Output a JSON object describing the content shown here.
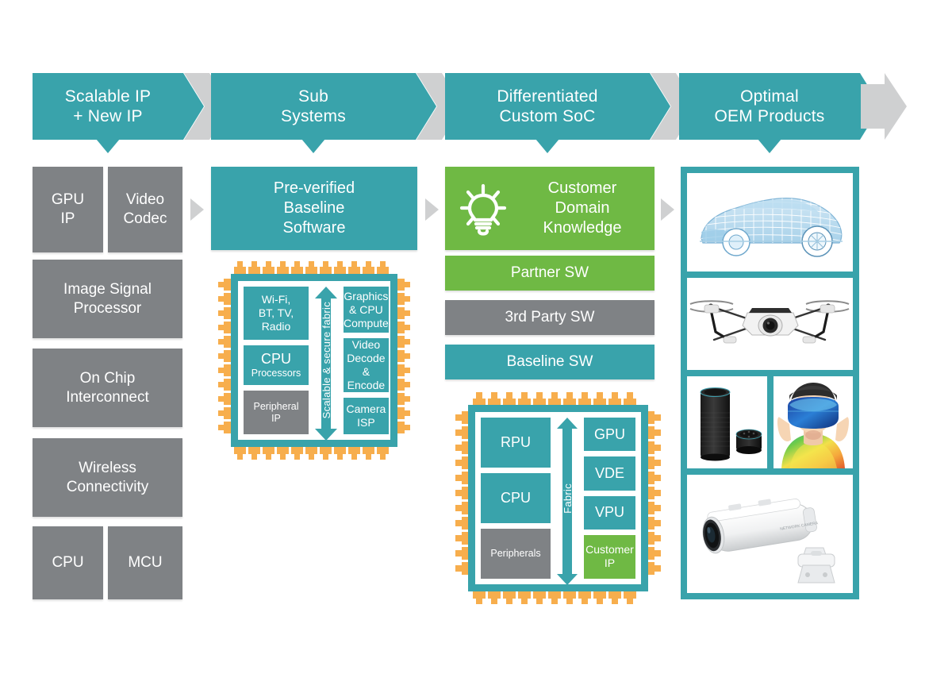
{
  "theme": {
    "teal": "#39A3AB",
    "green": "#6FB944",
    "gray": "#7F8285",
    "orange": "#F7AE4D",
    "arrow_gray": "#CFD0D1",
    "white": "#FFFFFF"
  },
  "headers": [
    {
      "label": "Scalable IP\n+ New IP",
      "name": "header-scalable-ip"
    },
    {
      "label": "Sub\nSystems",
      "name": "header-sub-systems"
    },
    {
      "label": "Differentiated\nCustom SoC",
      "name": "header-differentiated-custom-soc"
    },
    {
      "label": "Optimal\nOEM Products",
      "name": "header-optimal-oem-products"
    }
  ],
  "column1": {
    "blocks": [
      {
        "label": "GPU\nIP",
        "color": "gray"
      },
      {
        "label": "Video\nCodec",
        "color": "gray"
      },
      {
        "label": "Image Signal\nProcessor",
        "color": "gray"
      },
      {
        "label": "On Chip\nInterconnect",
        "color": "gray"
      },
      {
        "label": "Wireless\nConnectivity",
        "color": "gray"
      },
      {
        "label": "CPU",
        "color": "gray"
      },
      {
        "label": "MCU",
        "color": "gray"
      }
    ]
  },
  "column2": {
    "software_block": {
      "label": "Pre-verified\nBaseline\nSoftware",
      "color": "teal"
    },
    "chip": {
      "fabric_label": "Scalable & secure fabric",
      "left_cells": [
        {
          "label": "Wi-Fi,\nBT, TV,\nRadio",
          "color": "teal",
          "style": "normal"
        },
        {
          "label": "CPU",
          "sublabel": "Processors",
          "color": "teal",
          "style": "two-line"
        },
        {
          "label": "Peripheral\nIP",
          "color": "gray",
          "style": "small"
        }
      ],
      "right_cells": [
        {
          "label": "Graphics\n& CPU\nCompute",
          "color": "teal"
        },
        {
          "label": "Video\nDecode\n& Encode",
          "color": "teal"
        },
        {
          "label": "Camera\nISP",
          "color": "teal"
        }
      ]
    }
  },
  "column3": {
    "blocks": [
      {
        "label": "Customer\nDomain\nKnowledge",
        "color": "green",
        "icon": "lightbulb-icon"
      },
      {
        "label": "Partner SW",
        "color": "green"
      },
      {
        "label": "3rd Party SW",
        "color": "gray"
      },
      {
        "label": "Baseline SW",
        "color": "teal"
      }
    ],
    "chip": {
      "fabric_label": "Fabric",
      "left_cells": [
        {
          "label": "RPU",
          "color": "teal"
        },
        {
          "label": "CPU",
          "color": "teal"
        },
        {
          "label": "Peripherals",
          "color": "gray",
          "style": "small"
        }
      ],
      "right_cells": [
        {
          "label": "GPU",
          "color": "teal"
        },
        {
          "label": "VDE",
          "color": "teal"
        },
        {
          "label": "VPU",
          "color": "teal"
        },
        {
          "label": "Customer\nIP",
          "color": "green",
          "style": "small"
        }
      ]
    }
  },
  "column4": {
    "images": [
      {
        "name": "product-image-car-wireframe",
        "alt": "automotive wireframe car"
      },
      {
        "name": "product-image-drone",
        "alt": "quadcopter drone"
      },
      {
        "name": "product-image-smart-speaker",
        "alt": "smart speaker and smart speaker puck"
      },
      {
        "name": "product-image-vr-headset",
        "alt": "person wearing VR headset"
      },
      {
        "name": "product-image-security-camera",
        "alt": "white security surveillance camera"
      }
    ]
  }
}
